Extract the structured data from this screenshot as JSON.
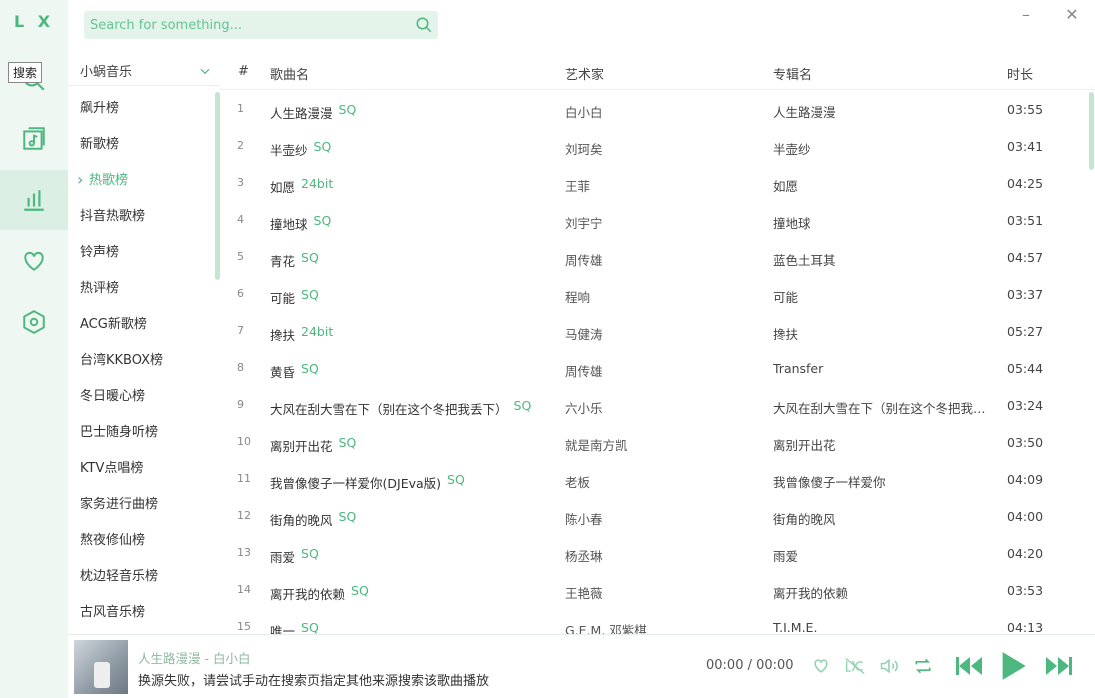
{
  "app": {
    "logo": "L X"
  },
  "rail": {
    "tooltip": "搜索"
  },
  "search": {
    "placeholder": "Search for something..."
  },
  "window": {
    "minimize": "–",
    "close": "✕"
  },
  "boards": {
    "source": "小蜗音乐",
    "items": [
      "飙升榜",
      "新歌榜",
      "热歌榜",
      "抖音热歌榜",
      "铃声榜",
      "热评榜",
      "ACG新歌榜",
      "台湾KKBOX榜",
      "冬日暖心榜",
      "巴士随身听榜",
      "KTV点唱榜",
      "家务进行曲榜",
      "熬夜修仙榜",
      "枕边轻音乐榜",
      "古风音乐榜"
    ],
    "active_index": 2
  },
  "table": {
    "headers": {
      "num": "#",
      "name": "歌曲名",
      "artist": "艺术家",
      "album": "专辑名",
      "duration": "时长"
    },
    "rows": [
      {
        "num": "1",
        "name": "人生路漫漫",
        "quality": "SQ",
        "artist": "白小白",
        "album": "人生路漫漫",
        "duration": "03:55"
      },
      {
        "num": "2",
        "name": "半壶纱",
        "quality": "SQ",
        "artist": "刘珂矣",
        "album": "半壶纱",
        "duration": "03:41"
      },
      {
        "num": "3",
        "name": "如愿",
        "quality": "24bit",
        "artist": "王菲",
        "album": "如愿",
        "duration": "04:25"
      },
      {
        "num": "4",
        "name": "撞地球",
        "quality": "SQ",
        "artist": "刘宇宁",
        "album": "撞地球",
        "duration": "03:51"
      },
      {
        "num": "5",
        "name": "青花",
        "quality": "SQ",
        "artist": "周传雄",
        "album": "蓝色土耳其",
        "duration": "04:57"
      },
      {
        "num": "6",
        "name": "可能",
        "quality": "SQ",
        "artist": "程响",
        "album": "可能",
        "duration": "03:37"
      },
      {
        "num": "7",
        "name": "搀扶",
        "quality": "24bit",
        "artist": "马健涛",
        "album": "搀扶",
        "duration": "05:27"
      },
      {
        "num": "8",
        "name": "黄昏",
        "quality": "SQ",
        "artist": "周传雄",
        "album": "Transfer",
        "duration": "05:44"
      },
      {
        "num": "9",
        "name": "大风在刮大雪在下（别在这个冬把我丢下）",
        "quality": "SQ",
        "artist": "六小乐",
        "album": "大风在刮大雪在下（别在这个冬把我丢下）",
        "duration": "03:24"
      },
      {
        "num": "10",
        "name": "离别开出花",
        "quality": "SQ",
        "artist": "就是南方凯",
        "album": "离别开出花",
        "duration": "03:50"
      },
      {
        "num": "11",
        "name": "我曾像傻子一样爱你(DJEva版)",
        "quality": "SQ",
        "artist": "老板",
        "album": "我曾像傻子一样爱你",
        "duration": "04:09"
      },
      {
        "num": "12",
        "name": "街角的晚风",
        "quality": "SQ",
        "artist": "陈小春",
        "album": "街角的晚风",
        "duration": "04:00"
      },
      {
        "num": "13",
        "name": "雨爱",
        "quality": "SQ",
        "artist": "杨丞琳",
        "album": "雨爱",
        "duration": "04:20"
      },
      {
        "num": "14",
        "name": "离开我的依赖",
        "quality": "SQ",
        "artist": "王艳薇",
        "album": "离开我的依赖",
        "duration": "03:53"
      },
      {
        "num": "15",
        "name": "唯一",
        "quality": "SQ",
        "artist": "G.E.M. 邓紫棋",
        "album": "T.I.M.E.",
        "duration": "04:13"
      }
    ]
  },
  "player": {
    "title": "人生路漫漫 - 白小白",
    "message": "换源失败，请尝试手动在搜索页指定其他来源搜索该歌曲播放",
    "time": "00:00 / 00:00"
  },
  "colors": {
    "accent": "#4cb77f",
    "rail_bg": "#eef7f2",
    "search_bg": "#e5f4eb"
  }
}
